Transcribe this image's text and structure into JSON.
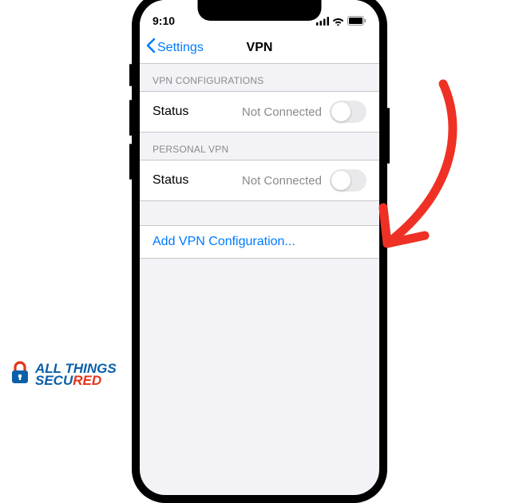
{
  "status_bar": {
    "time": "9:10"
  },
  "nav": {
    "back_label": "Settings",
    "title": "VPN"
  },
  "sections": {
    "vpn_configs": {
      "header": "VPN CONFIGURATIONS",
      "status_label": "Status",
      "status_value": "Not Connected"
    },
    "personal_vpn": {
      "header": "PERSONAL VPN",
      "status_label": "Status",
      "status_value": "Not Connected"
    }
  },
  "add_link": "Add VPN Configuration...",
  "logo": {
    "line1": "ALL THINGS",
    "line2_a": "SECU",
    "line2_b": "RED"
  },
  "colors": {
    "ios_blue": "#007aff",
    "annotation_red": "#ee3124",
    "logo_blue": "#0a5fa8",
    "logo_red": "#e63319"
  }
}
